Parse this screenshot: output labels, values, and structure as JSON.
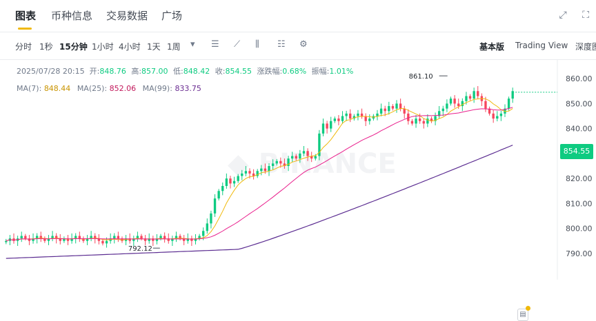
{
  "tabs": [
    {
      "label": "图表"
    },
    {
      "label": "币种信息"
    },
    {
      "label": "交易数据"
    },
    {
      "label": "广场"
    }
  ],
  "toolbar": {
    "intervals": [
      "分时",
      "1秒",
      "15分钟",
      "1小时",
      "4小时",
      "1天",
      "1周"
    ],
    "active_interval": "15分钟",
    "views": [
      "基本版",
      "Trading View",
      "深度图"
    ]
  },
  "ohlc": {
    "datetime": "2025/07/28 20:15",
    "open_label": "开:",
    "open": "848.76",
    "high_label": "高:",
    "high": "857.00",
    "low_label": "低:",
    "low": "848.42",
    "close_label": "收:",
    "close": "854.55",
    "change_label": "涨跌幅:",
    "change": "0.68%",
    "amp_label": "振幅:",
    "amp": "1.01%"
  },
  "ma": {
    "ma7_label": "MA(7):",
    "ma7": "848.44",
    "ma25_label": "MA(25):",
    "ma25": "852.06",
    "ma99_label": "MA(99):",
    "ma99": "833.75"
  },
  "colors": {
    "up": "#0ecb81",
    "down": "#f6465d",
    "ma7": "#f0b90b",
    "ma25": "#e91e8c",
    "ma99": "#5b2c91",
    "accent": "#f0b90b"
  },
  "chart_data": {
    "type": "candlestick",
    "y_ticks": [
      "860.00",
      "850.00",
      "840.00",
      "830.00",
      "820.00",
      "810.00",
      "800.00",
      "790.00"
    ],
    "ylim": [
      785,
      865
    ],
    "last_price": "854.55",
    "annotations": {
      "high": "861.10",
      "low": "792.12"
    },
    "close_series": [
      795,
      796,
      795,
      796,
      797,
      796,
      795,
      796,
      797,
      796,
      795,
      796,
      797,
      796,
      795,
      796,
      795,
      796,
      797,
      796,
      795,
      796,
      797,
      796,
      795,
      794,
      795,
      796,
      797,
      796,
      795,
      796,
      795,
      796,
      797,
      796,
      795,
      796,
      795,
      796,
      797,
      796,
      795,
      796,
      797,
      796,
      795,
      796,
      795,
      796,
      797,
      799,
      802,
      806,
      812,
      815,
      817,
      820,
      818,
      819,
      821,
      822,
      823,
      822,
      821,
      823,
      824,
      823,
      825,
      826,
      827,
      826,
      825,
      828,
      829,
      828,
      830,
      831,
      829,
      828,
      829,
      838,
      842,
      840,
      843,
      844,
      843,
      845,
      846,
      844,
      845,
      846,
      845,
      843,
      844,
      845,
      846,
      848,
      847,
      849,
      848,
      850,
      848,
      846,
      843,
      842,
      844,
      843,
      842,
      844,
      843,
      845,
      847,
      848,
      850,
      852,
      850,
      849,
      851,
      853,
      852,
      855,
      853,
      851,
      848,
      846,
      844,
      845,
      846,
      848,
      852,
      855
    ],
    "ma7_label_series": "MA(7)",
    "ma25_label_series": "MA(25)",
    "ma99_label_series": "MA(99)"
  }
}
